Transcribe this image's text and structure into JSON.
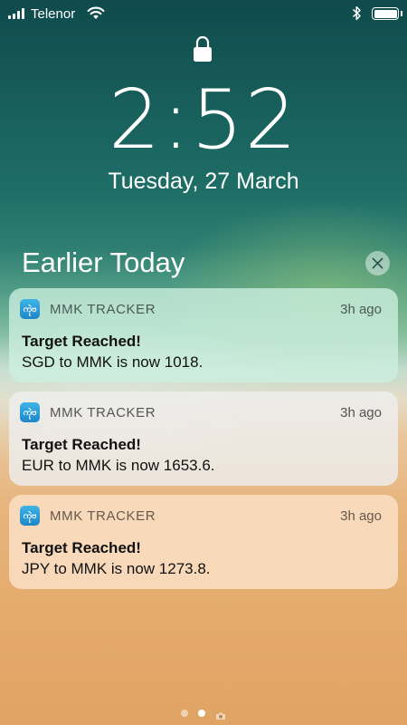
{
  "status_bar": {
    "carrier": "Telenor",
    "battery_level": 1.0,
    "signal_bars": 4,
    "icons": [
      "signal-icon",
      "wifi-icon",
      "bluetooth-icon",
      "battery-icon"
    ]
  },
  "lock_screen": {
    "time": "2:52",
    "date": "Tuesday, 27 March",
    "lock_icon": "lock-icon"
  },
  "notification_center": {
    "section_title": "Earlier Today",
    "clear_icon": "close-icon"
  },
  "notifications": [
    {
      "app_icon_text": "ကုဲဗ",
      "app_name": "MMK TRACKER",
      "time_ago": "3h ago",
      "title": "Target Reached!",
      "body": "SGD to MMK is now 1018."
    },
    {
      "app_icon_text": "ကုဲဗ",
      "app_name": "MMK TRACKER",
      "time_ago": "3h ago",
      "title": "Target Reached!",
      "body": "EUR to MMK is now 1653.6."
    },
    {
      "app_icon_text": "ကုဲဗ",
      "app_name": "MMK TRACKER",
      "time_ago": "3h ago",
      "title": "Target Reached!",
      "body": "JPY to MMK is now 1273.8."
    }
  ],
  "page_indicator": {
    "pages": 2,
    "active_index": 1,
    "camera_icon": "camera-icon"
  },
  "colors": {
    "app_icon_top": "#3fb4e6",
    "app_icon_bottom": "#1e86c8",
    "wallpaper_sea": "#1e6e66",
    "wallpaper_sand": "#e4aa6c"
  }
}
